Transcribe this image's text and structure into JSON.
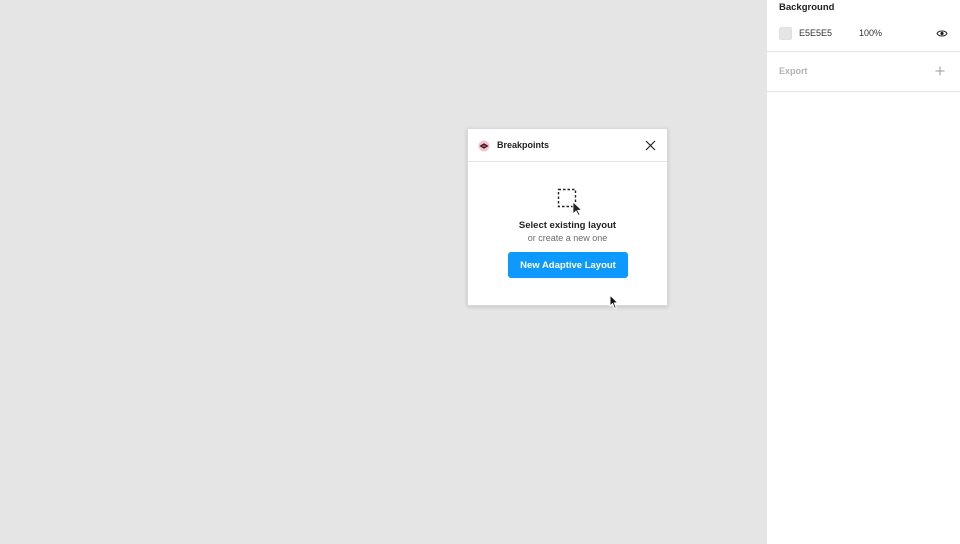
{
  "canvas": {
    "background_color": "#E5E5E5"
  },
  "right_panel": {
    "background_section": {
      "title": "Background",
      "hex_value": "E5E5E5",
      "opacity": "100%",
      "swatch_color": "#E5E5E5",
      "visibility_icon": "eye-icon"
    },
    "export_section": {
      "title": "Export",
      "add_icon": "plus-icon"
    }
  },
  "plugin_dialog": {
    "title": "Breakpoints",
    "plugin_icon": "breakpoints-logo-icon",
    "close_icon": "close-icon",
    "empty_state": {
      "icon": "select-layer-icon",
      "heading": "Select existing layout",
      "subtext": "or create a new one"
    },
    "primary_button_label": "New Adaptive Layout",
    "accent_color": "#0D99FF"
  }
}
